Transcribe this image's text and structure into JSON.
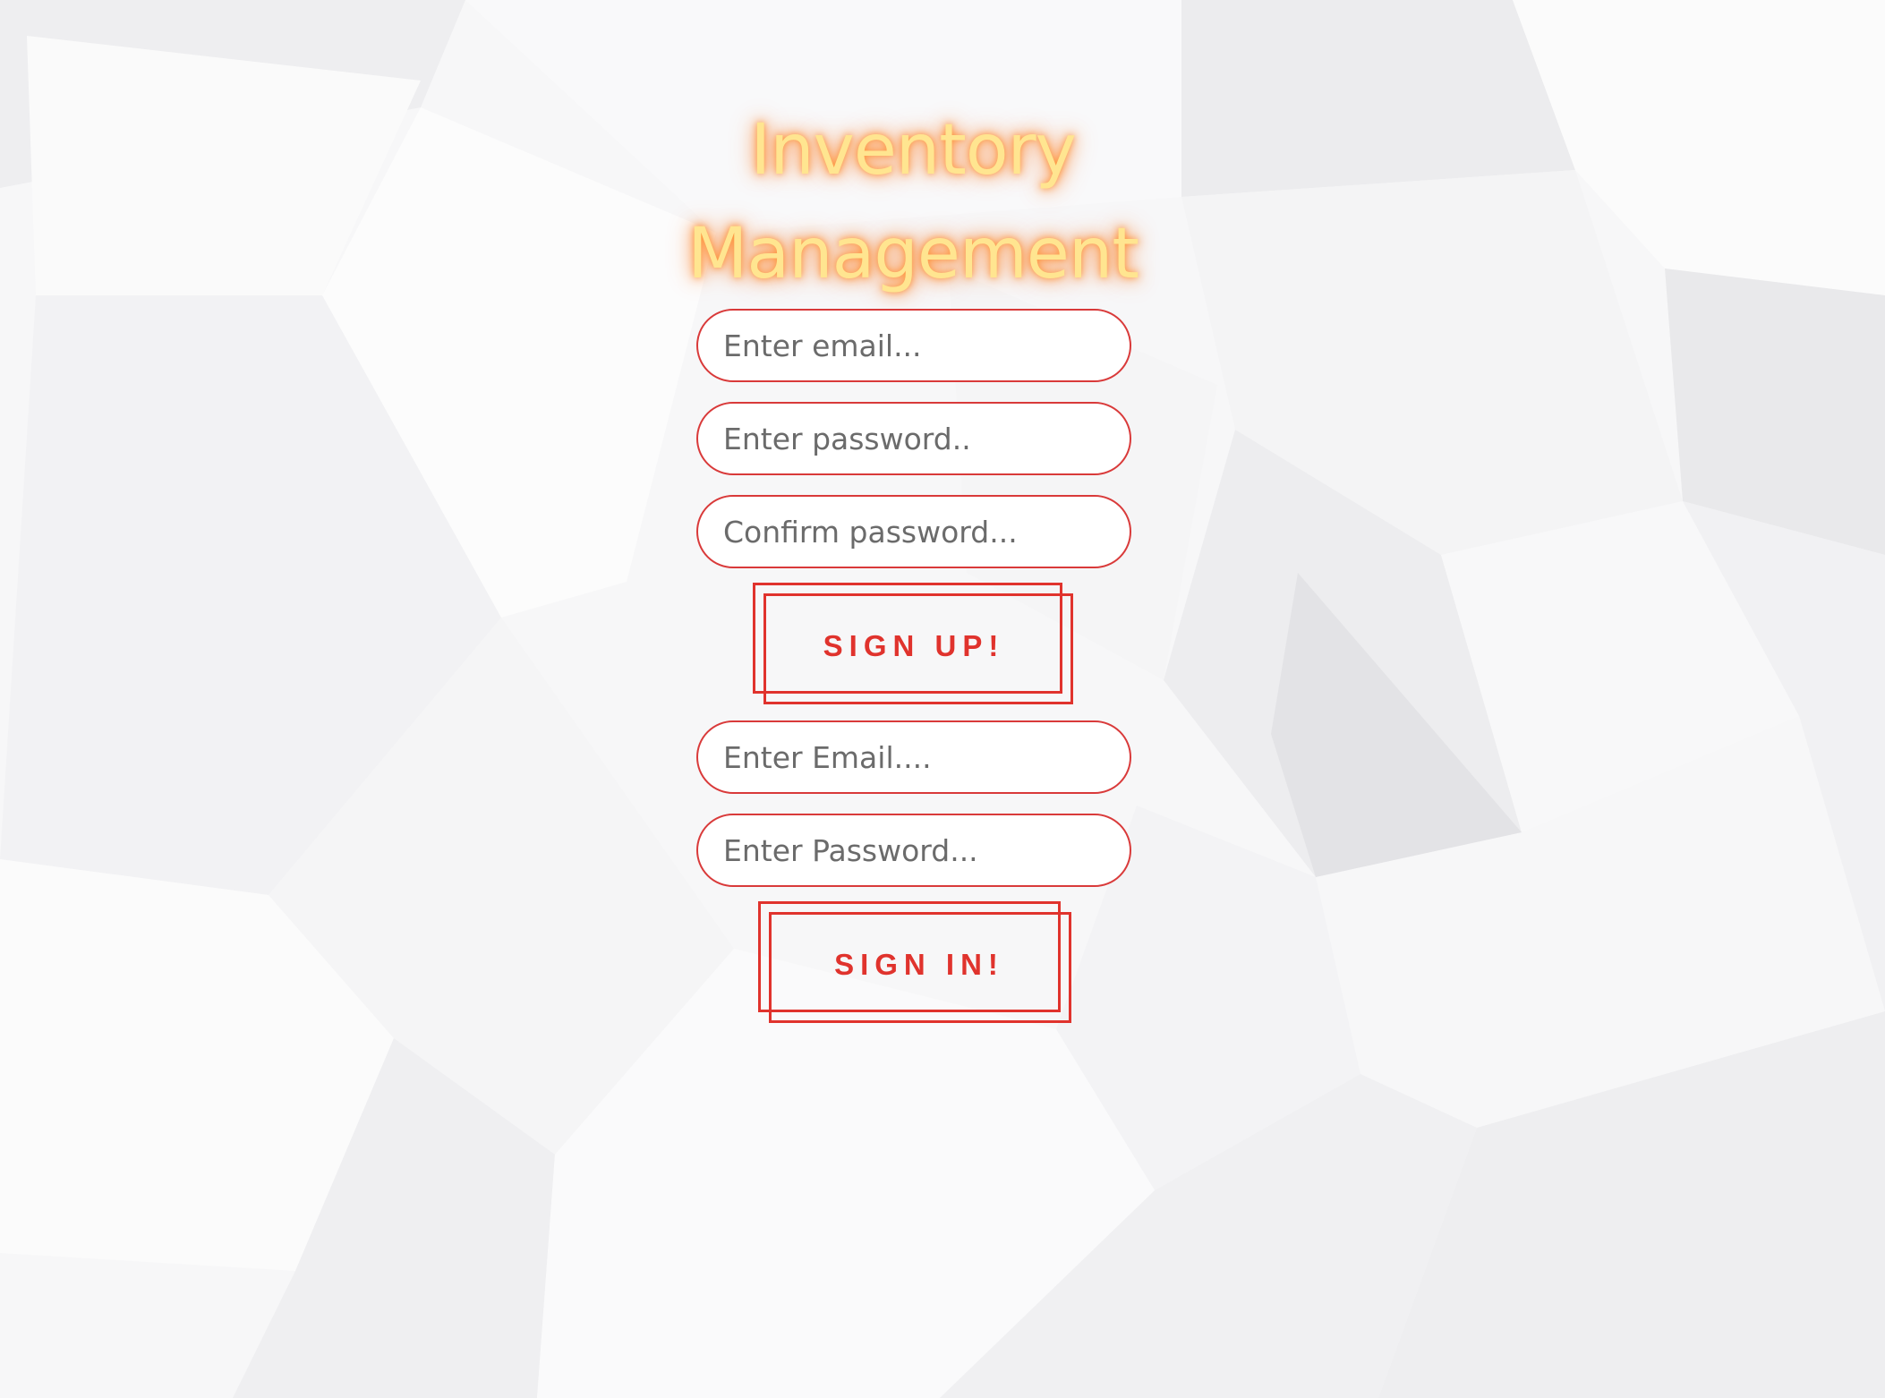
{
  "app": {
    "title_line1": "Inventory",
    "title_line2": "Management"
  },
  "signup": {
    "email_placeholder": "Enter email...",
    "password_placeholder": "Enter password..",
    "confirm_placeholder": "Confirm password...",
    "button_label": "SIGN UP!"
  },
  "signin": {
    "email_placeholder": "Enter Email....",
    "password_placeholder": "Enter Password...",
    "button_label": "SIGN IN!"
  },
  "colors": {
    "accent": "#e0332d",
    "title": "#ffe590",
    "title_glow": "#ff8c28"
  }
}
